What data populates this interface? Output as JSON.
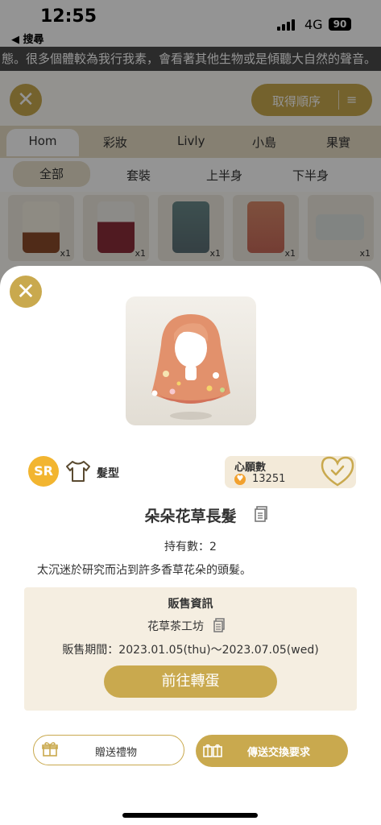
{
  "status": {
    "time": "12:55",
    "back_label": "◀ 搜尋",
    "network": "4G",
    "battery": "90"
  },
  "marquee": "態。很多個體較為我行我素，會看著其他生物或是傾聽大自然的聲音。",
  "toolbar": {
    "sort_label": "取得順序",
    "sort_icon": "≡"
  },
  "categories": [
    "Hom",
    "彩妝",
    "Livly",
    "小島",
    "果實"
  ],
  "subcategories": [
    "全部",
    "套裝",
    "上半身",
    "下半身"
  ],
  "items": [
    {
      "count": "x1"
    },
    {
      "count": "x1"
    },
    {
      "count": "x1"
    },
    {
      "count": "x1"
    },
    {
      "count": "x1"
    }
  ],
  "detail": {
    "rarity": "SR",
    "category_label": "髮型",
    "wish_title": "心願數",
    "wish_count": "13251",
    "name": "朵朵花草長髮",
    "owned": "持有數：2",
    "description": "太沉迷於研究而沾到許多香草花朵的頭髮。",
    "sale_title": "販售資訊",
    "shop": "花草茶工坊",
    "period": "販售期間：2023.01.05(thu)～2023.07.05(wed)",
    "gacha_button": "前往轉蛋",
    "gift_button": "贈送禮物",
    "trade_button": "傳送交換要求"
  },
  "colors": {
    "gold": "#c9a94e",
    "rarity": "#f2b530",
    "sale_bg": "#f5eee1"
  }
}
